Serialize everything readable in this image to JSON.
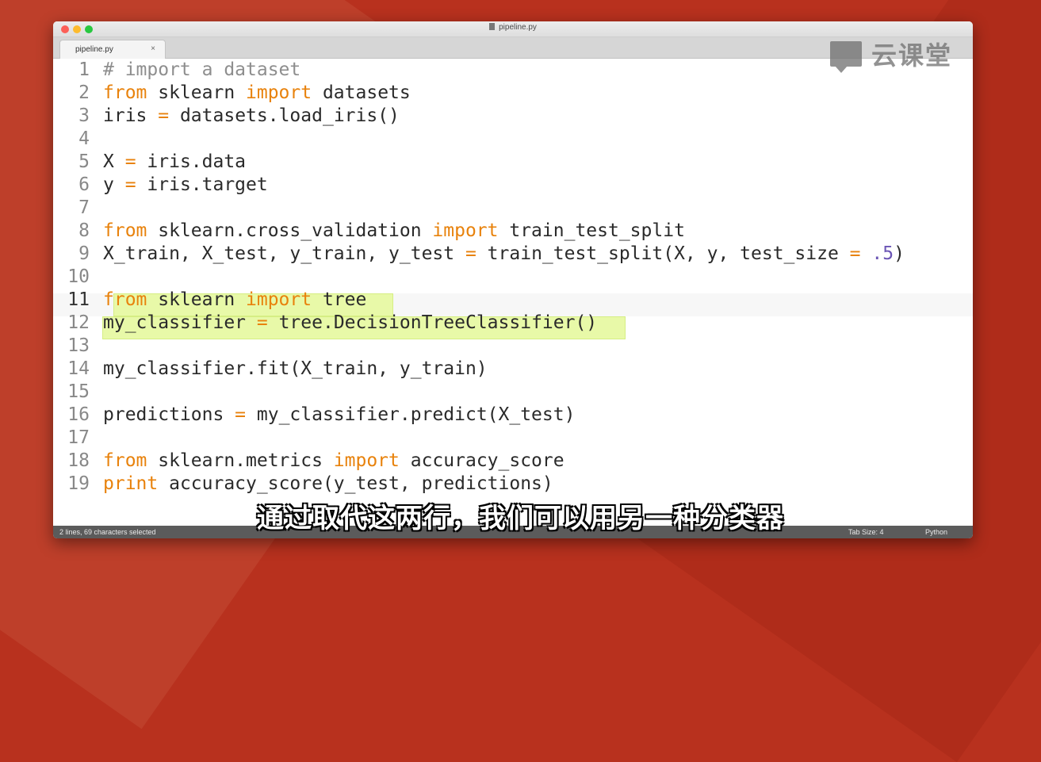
{
  "window": {
    "title": "pipeline.py"
  },
  "tab": {
    "label": "pipeline.py",
    "close": "×"
  },
  "watermark": {
    "text": "云课堂"
  },
  "code": {
    "lines": [
      {
        "n": "1",
        "tokens": [
          {
            "t": "# import a dataset",
            "c": "cm"
          }
        ]
      },
      {
        "n": "2",
        "tokens": [
          {
            "t": "from",
            "c": "kw"
          },
          {
            "t": " sklearn "
          },
          {
            "t": "import",
            "c": "kw"
          },
          {
            "t": " datasets"
          }
        ]
      },
      {
        "n": "3",
        "tokens": [
          {
            "t": "iris "
          },
          {
            "t": "=",
            "c": "op"
          },
          {
            "t": " datasets.load_iris()"
          }
        ]
      },
      {
        "n": "4",
        "tokens": []
      },
      {
        "n": "5",
        "tokens": [
          {
            "t": "X "
          },
          {
            "t": "=",
            "c": "op"
          },
          {
            "t": " iris.data"
          }
        ]
      },
      {
        "n": "6",
        "tokens": [
          {
            "t": "y "
          },
          {
            "t": "=",
            "c": "op"
          },
          {
            "t": " iris.target"
          }
        ]
      },
      {
        "n": "7",
        "tokens": []
      },
      {
        "n": "8",
        "tokens": [
          {
            "t": "from",
            "c": "kw"
          },
          {
            "t": " sklearn.cross_validation "
          },
          {
            "t": "import",
            "c": "kw"
          },
          {
            "t": " train_test_split"
          }
        ]
      },
      {
        "n": "9",
        "tokens": [
          {
            "t": "X_train, X_test, y_train, y_test "
          },
          {
            "t": "=",
            "c": "op"
          },
          {
            "t": " train_test_split(X, y, test_size "
          },
          {
            "t": "=",
            "c": "op"
          },
          {
            "t": " "
          },
          {
            "t": ".5",
            "c": "num"
          },
          {
            "t": ")"
          }
        ]
      },
      {
        "n": "10",
        "tokens": []
      },
      {
        "n": "11",
        "tokens": [
          {
            "t": "from",
            "c": "kw"
          },
          {
            "t": " sklearn "
          },
          {
            "t": "import",
            "c": "kw"
          },
          {
            "t": " tree"
          }
        ]
      },
      {
        "n": "12",
        "tokens": [
          {
            "t": "my_classifier "
          },
          {
            "t": "=",
            "c": "op"
          },
          {
            "t": " tree.DecisionTreeClassifier()"
          }
        ]
      },
      {
        "n": "13",
        "tokens": []
      },
      {
        "n": "14",
        "tokens": [
          {
            "t": "my_classifier.fit(X_train, y_train)"
          }
        ]
      },
      {
        "n": "15",
        "tokens": []
      },
      {
        "n": "16",
        "tokens": [
          {
            "t": "predictions "
          },
          {
            "t": "=",
            "c": "op"
          },
          {
            "t": " my_classifier.predict(X_test)"
          }
        ]
      },
      {
        "n": "17",
        "tokens": []
      },
      {
        "n": "18",
        "tokens": [
          {
            "t": "from",
            "c": "kw"
          },
          {
            "t": " sklearn.metrics "
          },
          {
            "t": "import",
            "c": "kw"
          },
          {
            "t": " accuracy_score"
          }
        ]
      },
      {
        "n": "19",
        "tokens": [
          {
            "t": "print",
            "c": "kw"
          },
          {
            "t": " accuracy_score(y_test, predictions)"
          }
        ]
      }
    ]
  },
  "status": {
    "selection": "2 lines, 69 characters selected",
    "tab_size": "Tab Size: 4",
    "language": "Python"
  },
  "subtitle": "通过取代这两行，我们可以用另一种分类器",
  "colors": {
    "keyword": "#e8820c",
    "number": "#6b55b5",
    "comment": "#8e8e8e",
    "selection": "#e8f9a8",
    "status_bar": "#5b5b5b"
  }
}
